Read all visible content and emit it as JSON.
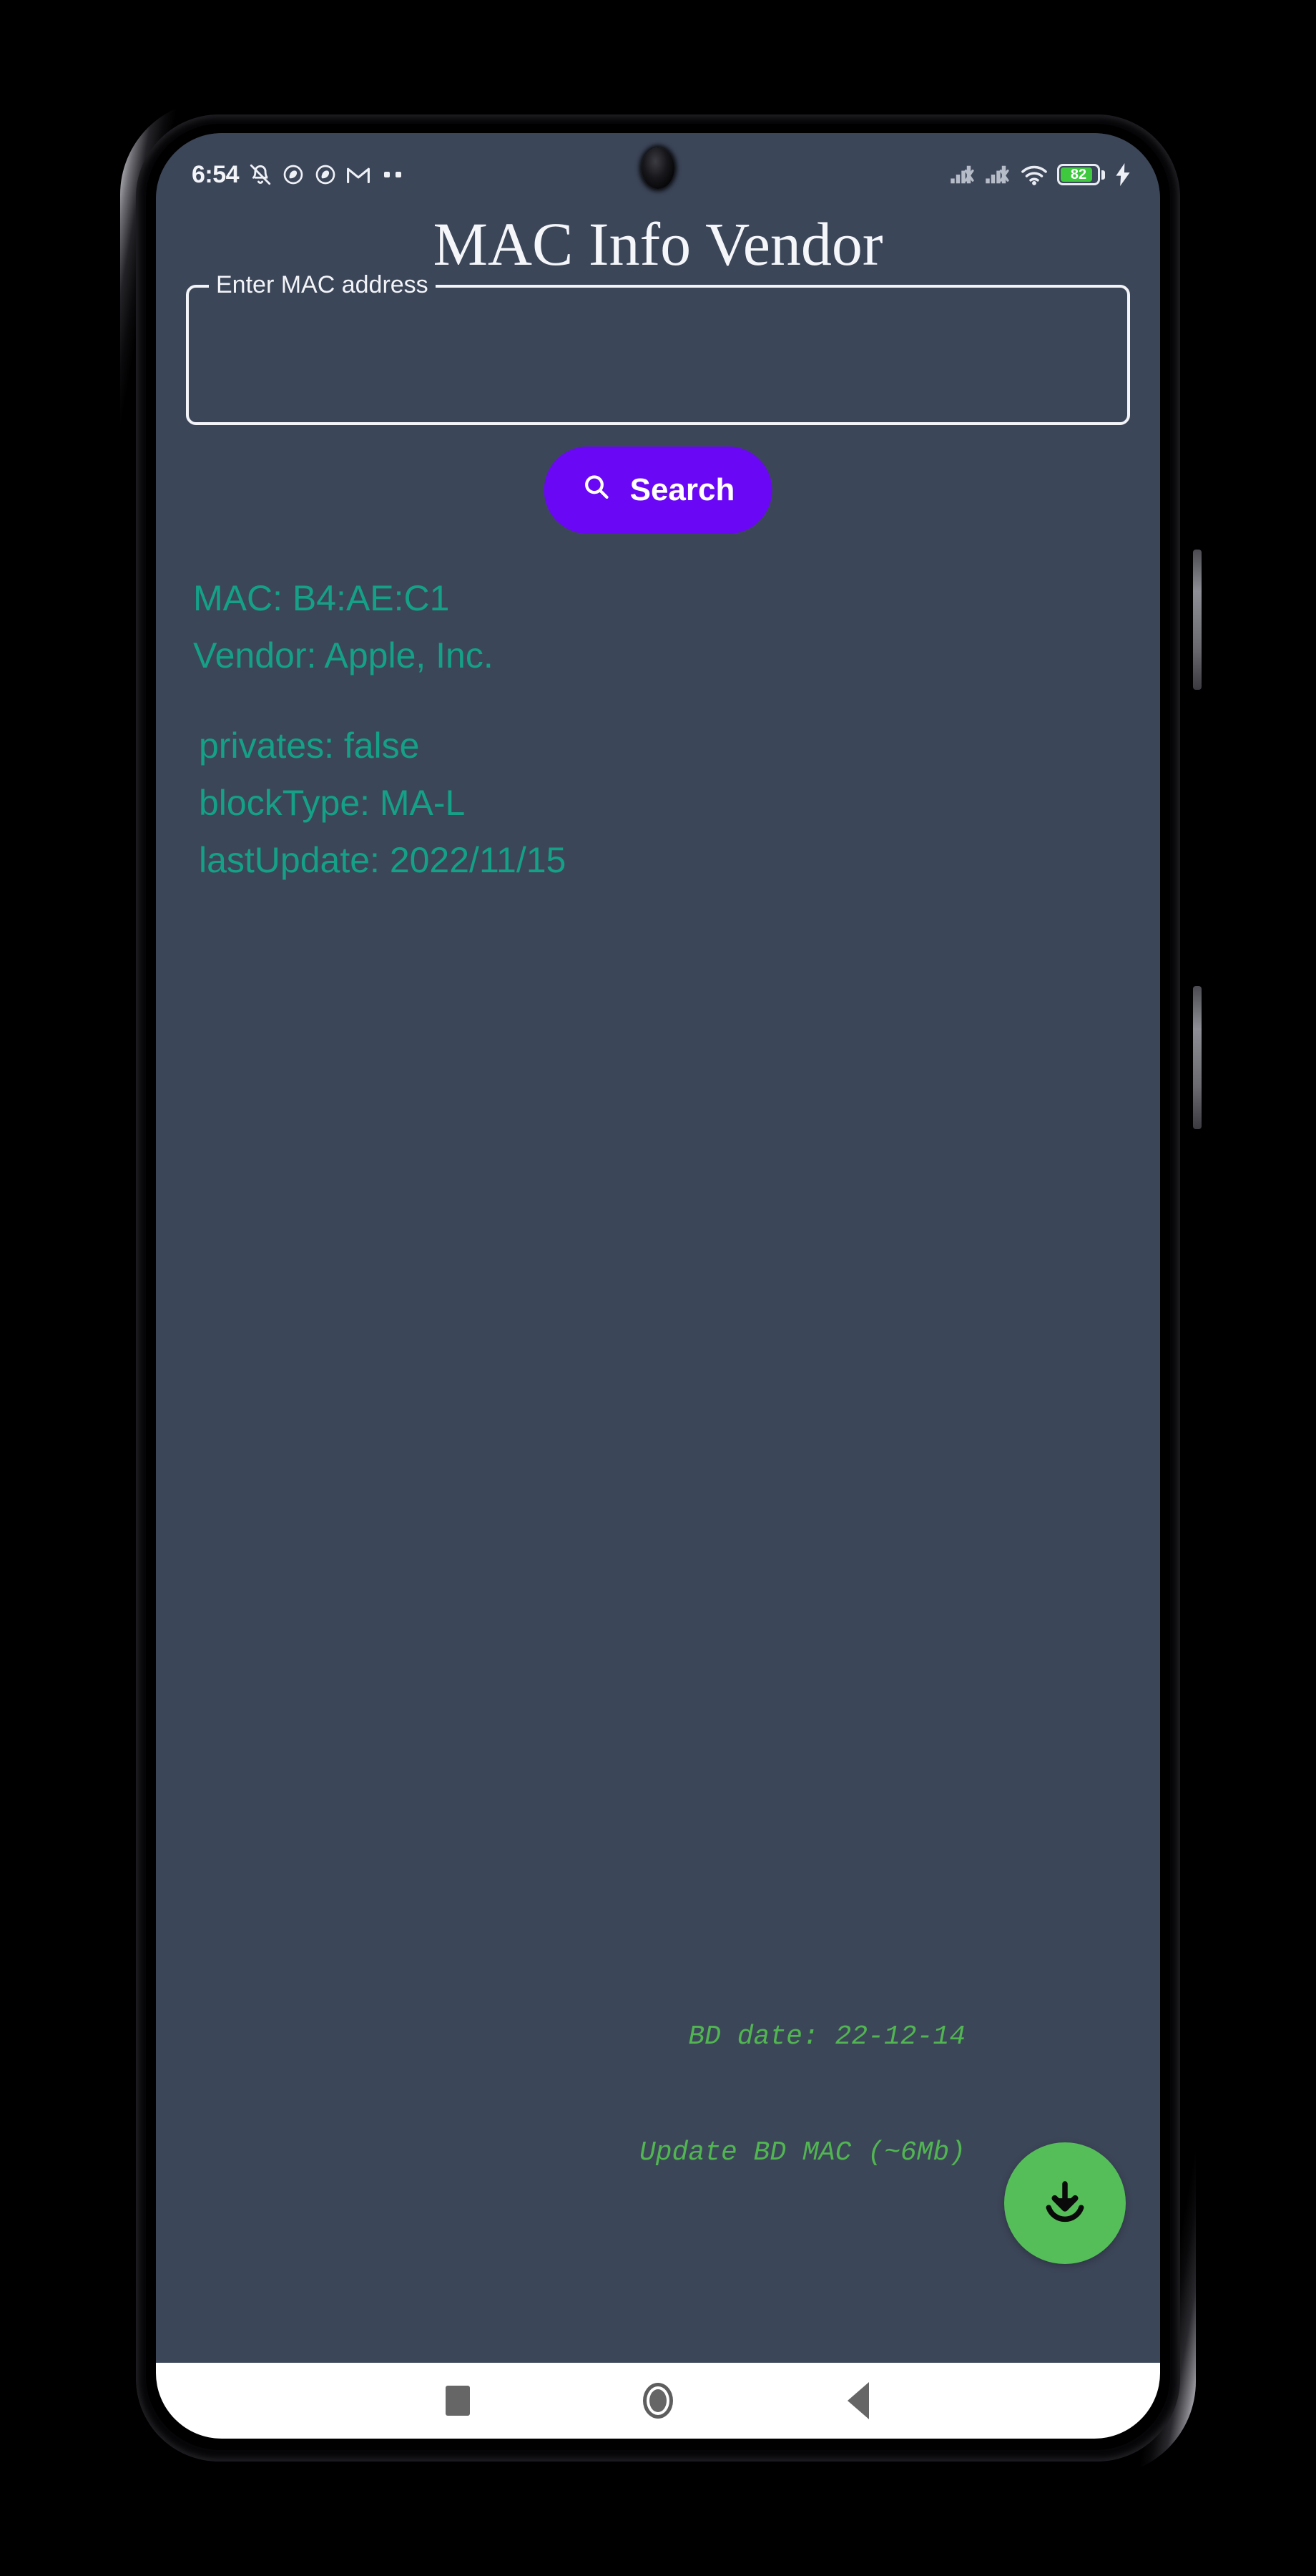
{
  "status_bar": {
    "time": "6:54",
    "left_icons": [
      "bell-muted-icon",
      "do-not-disturb-icon",
      "do-not-disturb-icon",
      "gmail-icon",
      "more-notifications-dots"
    ],
    "right_icons": [
      "signal-no-sim-icon",
      "signal-no-sim-icon",
      "wifi-icon"
    ],
    "battery_percent": "82",
    "battery_level": 82,
    "charging": true
  },
  "app": {
    "title": "MAC Info Vendor",
    "mac_field": {
      "label": "Enter MAC address",
      "value": "",
      "placeholder": ""
    },
    "search_button": {
      "label": "Search",
      "icon": "search-icon",
      "color": "#6a08f5"
    },
    "results": {
      "mac": "MAC: B4:AE:C1",
      "vendor": "Vendor: Apple, Inc.",
      "privates": "privates: false",
      "block_type": "blockType: MA-L",
      "last_update": "lastUpdate: 2022/11/15",
      "color": "#14a188"
    },
    "footer": {
      "bd_date": "BD date: 22-12-14",
      "update_label": "Update BD MAC (~6Mb)",
      "text_color": "#51b551",
      "fab": {
        "icon": "download-icon",
        "color": "#56be59"
      }
    },
    "background_color": "#3c4659"
  },
  "nav_bar": {
    "recents": "recents-square-button",
    "home": "home-circle-button",
    "back": "back-triangle-button"
  }
}
